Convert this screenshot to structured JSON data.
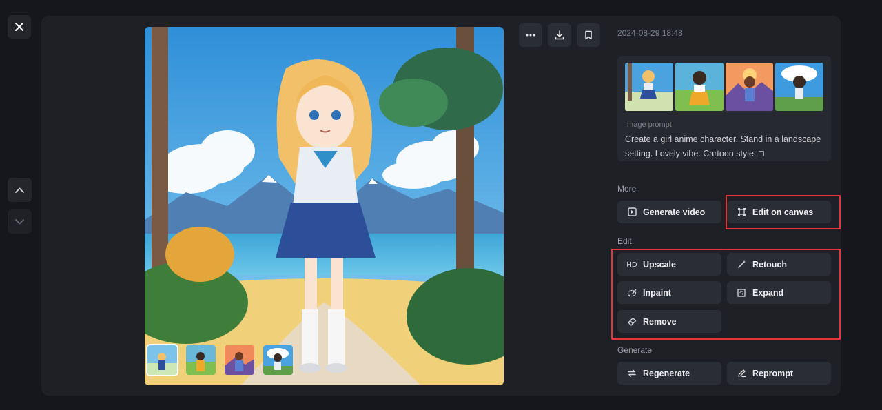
{
  "timestamp": "2024-08-29 18:48",
  "prompt": {
    "label": "Image prompt",
    "text": "Create a girl anime character. Stand in a landscape setting. Lovely vibe. Cartoon style."
  },
  "sections": {
    "more": "More",
    "edit": "Edit",
    "generate": "Generate"
  },
  "buttons": {
    "generate_video": "Generate video",
    "edit_on_canvas": "Edit on canvas",
    "upscale": "Upscale",
    "upscale_badge": "HD",
    "retouch": "Retouch",
    "inpaint": "Inpaint",
    "expand": "Expand",
    "remove": "Remove",
    "regenerate": "Regenerate",
    "reprompt": "Reprompt"
  },
  "icons": [
    "close-icon",
    "chevron-up-icon",
    "chevron-down-icon",
    "more-icon",
    "download-icon",
    "bookmark-icon",
    "copy-icon",
    "video-icon",
    "canvas-icon",
    "hd-icon",
    "retouch-icon",
    "inpaint-icon",
    "expand-icon",
    "eraser-icon",
    "regenerate-icon",
    "pen-icon"
  ],
  "colors": {
    "background": "#15171c",
    "panel": "#1e2026",
    "button": "#2b2d34",
    "highlight": "#e6343a"
  }
}
